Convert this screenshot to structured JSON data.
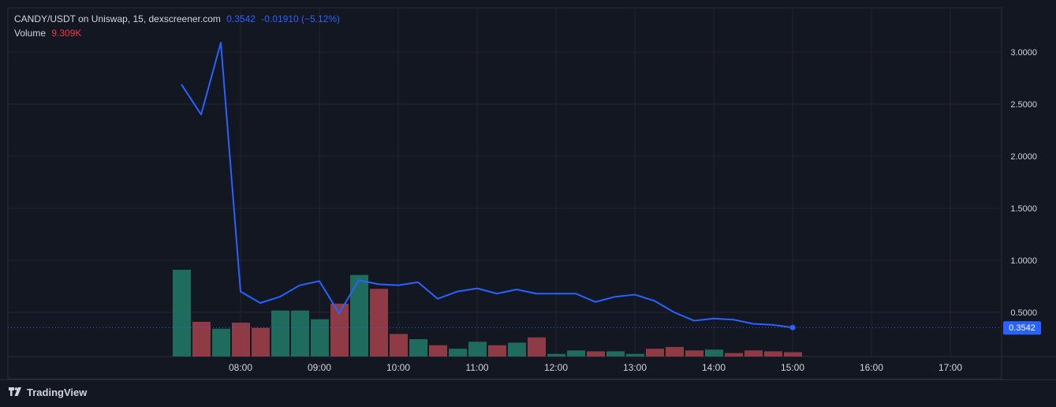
{
  "legend": {
    "title": "CANDY/USDT on Uniswap, 15, dexscreener.com",
    "last": "0.3542",
    "change": "-0.01910 (−5.12%)",
    "volume_label": "Volume",
    "volume_value": "9.309K"
  },
  "footer": {
    "brand": "TradingView"
  },
  "colors": {
    "background": "#131722",
    "grid": "#232632",
    "line": "#2962ff",
    "volume_up": "#1f6b5e",
    "volume_down": "#8e3b46",
    "axis_text": "#d1d4dc"
  },
  "chart_data": {
    "type": "line",
    "title": "CANDY/USDT on Uniswap, 15, dexscreener.com",
    "last_price_label": "0.3542",
    "x_ticks": [
      "08:00",
      "09:00",
      "10:00",
      "11:00",
      "12:00",
      "13:00",
      "14:00",
      "15:00",
      "16:00",
      "17:00"
    ],
    "y_ticks": [
      "0.5000",
      "1.0000",
      "1.5000",
      "2.0000",
      "2.5000",
      "3.0000"
    ],
    "ylim": [
      0.0,
      3.4
    ],
    "series": [
      {
        "type": "line",
        "x": [
          "07:15",
          "07:30",
          "07:45",
          "08:00",
          "08:15",
          "08:30",
          "08:45",
          "09:00",
          "09:15",
          "09:30",
          "09:45",
          "10:00",
          "10:15",
          "10:30",
          "10:45",
          "11:00",
          "11:15",
          "11:30",
          "11:45",
          "12:00",
          "12:15",
          "12:30",
          "12:45",
          "13:00",
          "13:15",
          "13:30",
          "13:45",
          "14:00",
          "14:15",
          "14:30",
          "14:45",
          "15:00"
        ],
        "values": [
          2.69,
          2.4,
          3.09,
          0.7,
          0.59,
          0.65,
          0.76,
          0.8,
          0.49,
          0.81,
          0.77,
          0.76,
          0.79,
          0.63,
          0.7,
          0.73,
          0.68,
          0.72,
          0.68,
          0.68,
          0.68,
          0.6,
          0.65,
          0.67,
          0.61,
          0.5,
          0.42,
          0.44,
          0.43,
          0.39,
          0.38,
          0.3542
        ]
      },
      {
        "name": "Volume",
        "type": "bar",
        "x": [
          "07:15",
          "07:30",
          "07:45",
          "08:00",
          "08:15",
          "08:30",
          "08:45",
          "09:00",
          "09:15",
          "09:30",
          "09:45",
          "10:00",
          "10:15",
          "10:30",
          "10:45",
          "11:00",
          "11:15",
          "11:30",
          "11:45",
          "12:00",
          "12:15",
          "12:30",
          "12:45",
          "13:00",
          "13:15",
          "13:30",
          "13:45",
          "14:00",
          "14:15",
          "14:30",
          "14:45",
          "15:00"
        ],
        "values": [
          1.0,
          0.4,
          0.32,
          0.39,
          0.33,
          0.53,
          0.53,
          0.43,
          0.61,
          0.94,
          0.78,
          0.26,
          0.2,
          0.13,
          0.09,
          0.17,
          0.13,
          0.16,
          0.22,
          0.03,
          0.07,
          0.06,
          0.06,
          0.03,
          0.09,
          0.11,
          0.07,
          0.08,
          0.04,
          0.07,
          0.06,
          0.05
        ],
        "direction": [
          "up",
          "down",
          "up",
          "down",
          "down",
          "up",
          "up",
          "up",
          "down",
          "up",
          "down",
          "down",
          "up",
          "down",
          "up",
          "up",
          "down",
          "up",
          "down",
          "up",
          "up",
          "down",
          "up",
          "up",
          "down",
          "down",
          "down",
          "up",
          "down",
          "down",
          "down",
          "down"
        ]
      }
    ]
  }
}
